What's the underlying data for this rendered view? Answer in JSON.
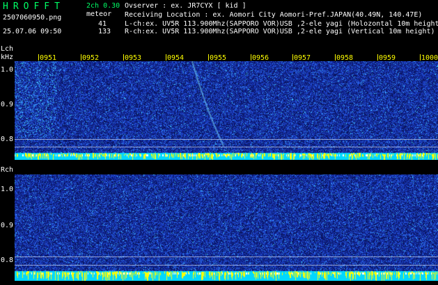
{
  "header": {
    "logo": "HROFFT",
    "version": "2ch 0.30",
    "mode": "meteor",
    "file_name": "2507060950.png",
    "datetime": "25.07.06 09:50",
    "count_l": "41",
    "count_r": "133",
    "observer": "Ovserver                : ex. JR7CYX [ kid ]",
    "location": "Receiving Location : ex. Aomori City Aomori-Pref.JAPAN(40.49N, 140.47E)",
    "lch_desc": "L-ch:ex. UV5R 113.900Mhz(SAPPORO VOR)USB ,2-ele yagi (Holozontal 10m height",
    "rch_desc": "R-ch:ex. UV5R 113.900Mhz(SAPPORO VOR)USB ,2-ele yagi (Vertical 10m height)"
  },
  "time_ticks": [
    "0951",
    "0952",
    "0953",
    "0954",
    "0955",
    "0956",
    "0957",
    "0958",
    "0959",
    "1000"
  ],
  "lch": {
    "label": "Lch",
    "unit": "kHz",
    "freq_ticks": [
      "1.0",
      "0.9",
      "0.8"
    ]
  },
  "rch": {
    "label": "Rch",
    "freq_ticks": [
      "1.0",
      "0.9",
      "0.8"
    ]
  },
  "colors": {
    "background": "#000000",
    "noise_dark": "#0a1a6e",
    "noise_mid": "#1f46c8",
    "noise_bright": "#33c8ff",
    "carrier": "#00e5ff",
    "carrier_peak": "#ffff00",
    "logo": "#00ff66",
    "tick": "#ffff00"
  }
}
